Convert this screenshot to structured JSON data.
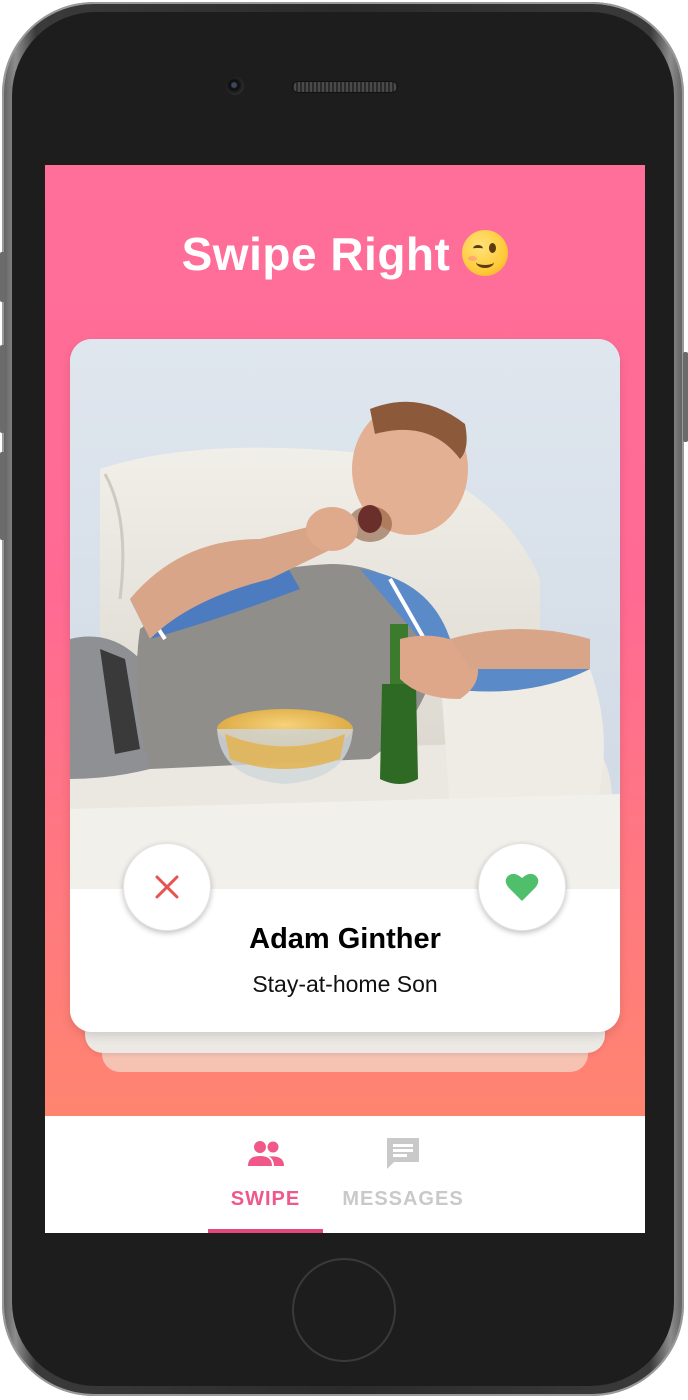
{
  "header": {
    "title": "Swipe Right",
    "emoji_icon": "winking-face-emoji"
  },
  "profile_card": {
    "name": "Adam Ginther",
    "subtitle": "Stay-at-home Son",
    "photo": "man-on-couch-eating-chips-photo"
  },
  "actions": {
    "nope_icon": "close-icon",
    "like_icon": "heart-icon"
  },
  "tabs": [
    {
      "label": "SWIPE",
      "icon": "people-icon",
      "active": true
    },
    {
      "label": "MESSAGES",
      "icon": "message-icon",
      "active": false
    }
  ],
  "colors": {
    "gradient_top": "#ff6f9a",
    "gradient_bottom": "#ff8a68",
    "active_tab": "#ef5888",
    "inactive_tab": "#c9c9c9",
    "nope": "#e8534f",
    "like": "#4fbf6c"
  }
}
